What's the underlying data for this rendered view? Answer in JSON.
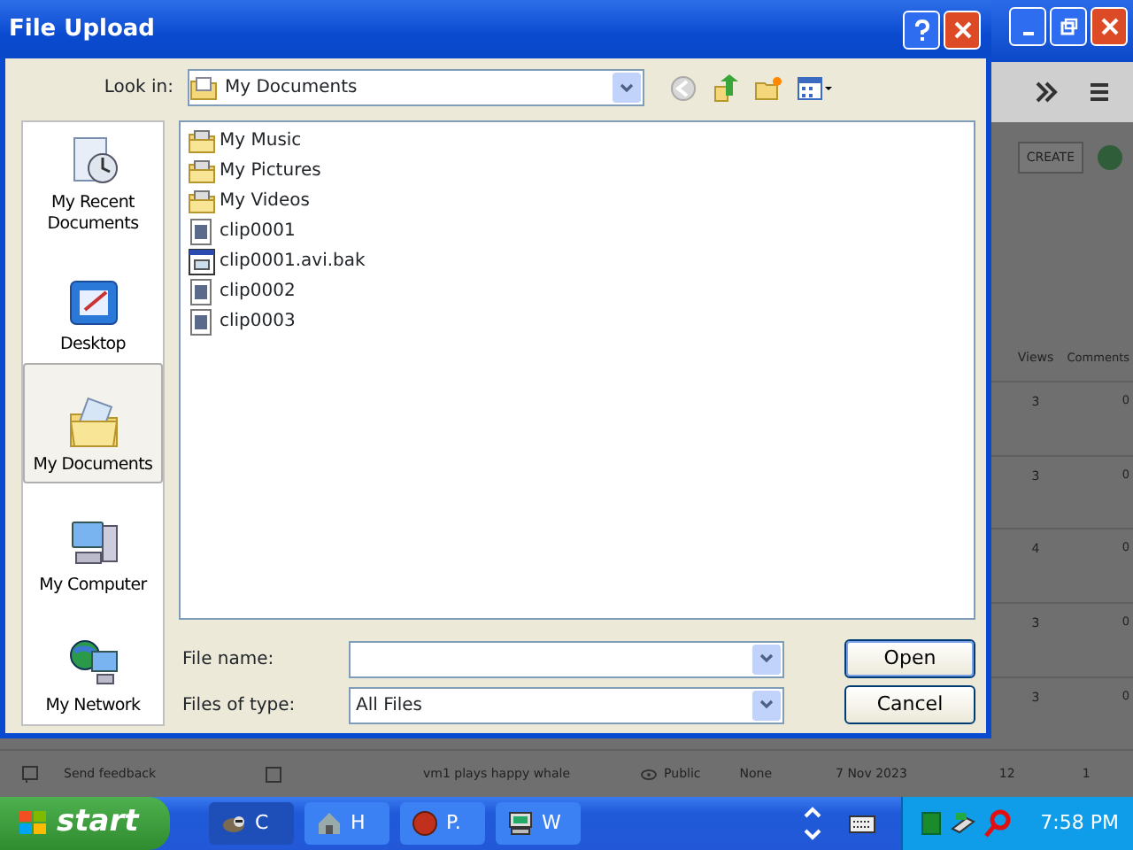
{
  "browser": {
    "create_button": "CREATE",
    "table": {
      "columns": [
        "Views",
        "Comments"
      ],
      "rows": [
        {
          "views": "3",
          "comments": "0"
        },
        {
          "views": "3",
          "comments": "0"
        },
        {
          "views": "4",
          "comments": "0"
        },
        {
          "views": "3",
          "comments": "0"
        },
        {
          "views": "3",
          "comments": "0"
        }
      ]
    },
    "sidebar_link": "Send feedback",
    "last_row": {
      "title": "vm1 plays happy whale",
      "visibility": "Public",
      "restrictions": "None",
      "date": "7 Nov 2023",
      "views": "12",
      "comments": "1",
      "checked": false
    }
  },
  "dialog": {
    "title": "File Upload",
    "look_in": {
      "label": "Look in:",
      "value": "My Documents"
    },
    "places": [
      {
        "label": "My Recent Documents",
        "kind": "recent",
        "selected": false
      },
      {
        "label": "Desktop",
        "kind": "desktop",
        "selected": false
      },
      {
        "label": "My Documents",
        "kind": "documents",
        "selected": true
      },
      {
        "label": "My Computer",
        "kind": "computer",
        "selected": false
      },
      {
        "label": "My Network",
        "kind": "network",
        "selected": false
      }
    ],
    "files": [
      {
        "name": "My Music",
        "kind": "folder"
      },
      {
        "name": "My Pictures",
        "kind": "folder"
      },
      {
        "name": "My Videos",
        "kind": "folder"
      },
      {
        "name": "clip0001",
        "kind": "video"
      },
      {
        "name": "clip0001.avi.bak",
        "kind": "file"
      },
      {
        "name": "clip0002",
        "kind": "video"
      },
      {
        "name": "clip0003",
        "kind": "video"
      }
    ],
    "file_name": {
      "label": "File name:"
    },
    "files_of_type": {
      "label": "Files of type:",
      "value": "All Files"
    },
    "buttons": [
      {
        "label": "Open",
        "default": true
      },
      {
        "label": "Cancel",
        "default": false
      }
    ]
  },
  "taskbar": {
    "start": "start",
    "tasks": [
      {
        "label": "C",
        "kind": "raccoon",
        "selected": true
      },
      {
        "label": "H",
        "kind": "house",
        "selected": false
      },
      {
        "label": "P.",
        "kind": "ball",
        "selected": false
      },
      {
        "label": "W",
        "kind": "monitor",
        "selected": false
      }
    ],
    "clock": "7:58 PM"
  }
}
